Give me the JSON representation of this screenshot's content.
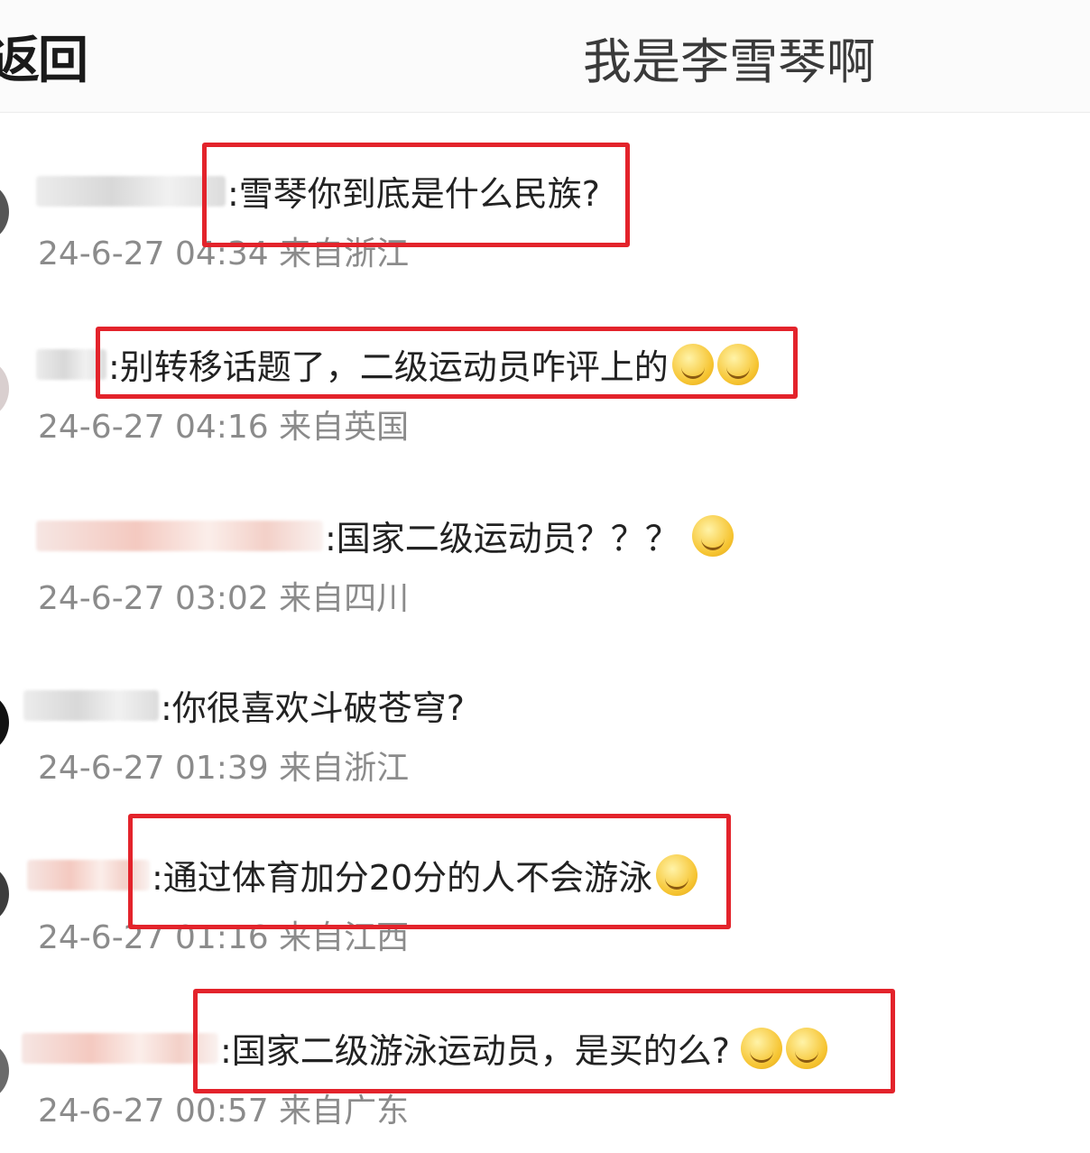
{
  "header": {
    "back_label": "返回",
    "title": "我是李雪琴啊"
  },
  "comments": [
    {
      "text": ":雪琴你到底是什么民族?",
      "time": "24-6-27 04:34",
      "location": "来自浙江",
      "emojis": [],
      "highlighted": true
    },
    {
      "text": ":别转移话题了，二级运动员咋评上的",
      "time": "24-6-27 04:16",
      "location": "来自英国",
      "emojis": [
        "laugh-cry-emoji",
        "laugh-cry-emoji"
      ],
      "highlighted": true
    },
    {
      "text": ":国家二级运动员？？？",
      "time": "24-6-27 03:02",
      "location": "来自四川",
      "emojis": [
        "smile-emoji"
      ],
      "highlighted": false
    },
    {
      "text": ":你很喜欢斗破苍穹?",
      "time": "24-6-27 01:39",
      "location": "来自浙江",
      "emojis": [],
      "highlighted": false
    },
    {
      "text": ":通过体育加分20分的人不会游泳",
      "time": "24-6-27 01:16",
      "location": "来自江西",
      "emojis": [
        "666-emoji"
      ],
      "highlighted": true
    },
    {
      "text": ":国家二级游泳运动员，是买的么?",
      "time": "24-6-27 00:57",
      "location": "来自广东",
      "emojis": [
        "laugh-cry-emoji",
        "laugh-cry-emoji"
      ],
      "highlighted": true
    }
  ]
}
